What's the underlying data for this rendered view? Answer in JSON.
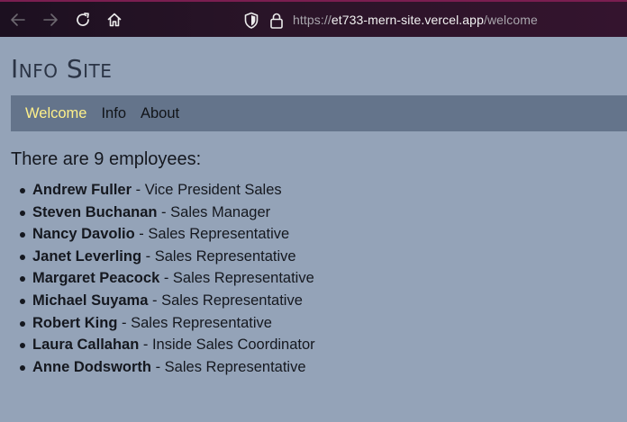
{
  "browser": {
    "url_prefix": "https://",
    "url_host": "et733-mern-site.vercel.app",
    "url_path": "/welcome"
  },
  "site": {
    "title": "Info Site"
  },
  "nav": {
    "items": [
      {
        "label": "Welcome"
      },
      {
        "label": "Info"
      },
      {
        "label": "About"
      }
    ]
  },
  "content": {
    "heading_prefix": "There are ",
    "employee_count": "9",
    "heading_suffix": " employees:",
    "separator": " - ",
    "employees": [
      {
        "name": "Andrew Fuller",
        "title": "Vice President Sales"
      },
      {
        "name": "Steven Buchanan",
        "title": "Sales Manager"
      },
      {
        "name": "Nancy Davolio",
        "title": "Sales Representative"
      },
      {
        "name": "Janet Leverling",
        "title": "Sales Representative"
      },
      {
        "name": "Margaret Peacock",
        "title": "Sales Representative"
      },
      {
        "name": "Michael Suyama",
        "title": "Sales Representative"
      },
      {
        "name": "Robert King",
        "title": "Sales Representative"
      },
      {
        "name": "Laura Callahan",
        "title": "Inside Sales Coordinator"
      },
      {
        "name": "Anne Dodsworth",
        "title": "Sales Representative"
      }
    ]
  },
  "colors": {
    "page_background": "#94a3b8",
    "nav_background": "#64748b",
    "nav_active": "#fef08a",
    "title_color": "#2b3445"
  },
  "icons": {
    "back": "arrow-left-icon",
    "forward": "arrow-right-icon",
    "reload": "reload-icon",
    "home": "home-icon",
    "shield": "shield-icon",
    "lock": "lock-icon"
  }
}
